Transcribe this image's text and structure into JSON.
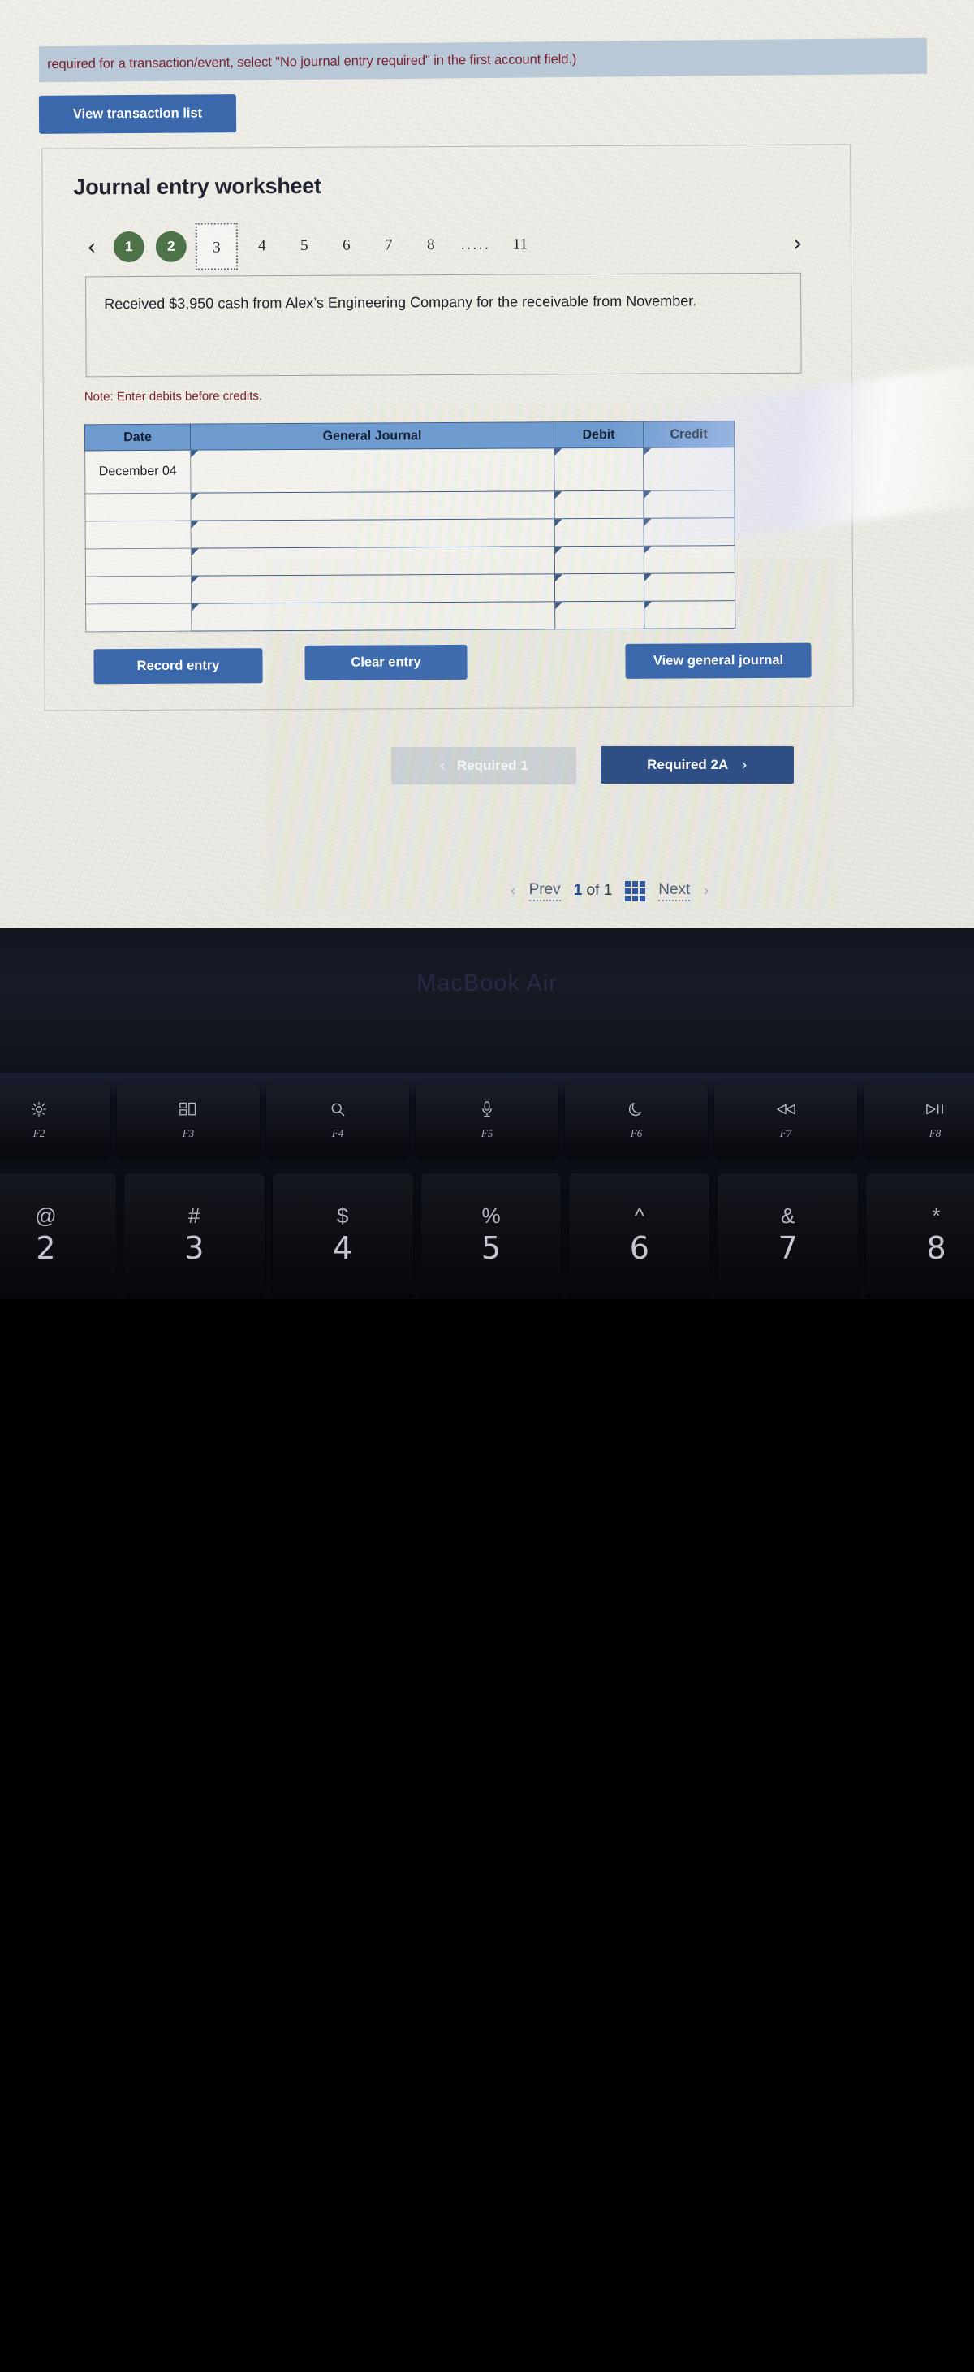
{
  "instruction": {
    "banner_text": "required for a transaction/event, select \"No journal entry required\" in the first account field.)"
  },
  "toolbar": {
    "view_transaction_list_label": "View transaction list"
  },
  "worksheet": {
    "title": "Journal entry worksheet",
    "prev_chevron": "‹",
    "next_chevron": "›",
    "tabs": [
      {
        "label": "1",
        "state": "completed"
      },
      {
        "label": "2",
        "state": "completed"
      },
      {
        "label": "3",
        "state": "current"
      },
      {
        "label": "4",
        "state": "normal"
      },
      {
        "label": "5",
        "state": "normal"
      },
      {
        "label": "6",
        "state": "normal"
      },
      {
        "label": "7",
        "state": "normal"
      },
      {
        "label": "8",
        "state": "normal"
      },
      {
        "label": ".....",
        "state": "ellipsis"
      },
      {
        "label": "11",
        "state": "normal"
      }
    ],
    "transaction_text": "Received $3,950 cash from Alex’s Engineering Company for the receivable from November.",
    "note": "Note: Enter debits before credits."
  },
  "table": {
    "headers": [
      "Date",
      "General Journal",
      "Debit",
      "Credit"
    ],
    "rows": [
      {
        "date": "December 04",
        "general_journal": "",
        "debit": "",
        "credit": ""
      },
      {
        "date": "",
        "general_journal": "",
        "debit": "",
        "credit": ""
      },
      {
        "date": "",
        "general_journal": "",
        "debit": "",
        "credit": ""
      },
      {
        "date": "",
        "general_journal": "",
        "debit": "",
        "credit": ""
      },
      {
        "date": "",
        "general_journal": "",
        "debit": "",
        "credit": ""
      },
      {
        "date": "",
        "general_journal": "",
        "debit": "",
        "credit": ""
      }
    ]
  },
  "actions": {
    "record_entry_label": "Record entry",
    "clear_entry_label": "Clear entry",
    "view_general_journal_label": "View general journal"
  },
  "required_nav": {
    "prev_label": "Required 1",
    "prev_chevron": "‹",
    "next_label": "Required 2A",
    "next_chevron": "›"
  },
  "pagination": {
    "prev_chevron": "‹",
    "prev_label": "Prev",
    "current_page": "1",
    "of_label": "of",
    "total_pages": "1",
    "next_label": "Next",
    "next_chevron": "›"
  },
  "device": {
    "model_label": "MacBook Air",
    "function_keys": [
      {
        "label": "F2",
        "icon": "brightness-icon",
        "glyph": "☼"
      },
      {
        "label": "F3",
        "icon": "mission-control-icon",
        "glyph": "☰"
      },
      {
        "label": "F4",
        "icon": "spotlight-search-icon",
        "glyph": "⚲"
      },
      {
        "label": "F5",
        "icon": "microphone-icon",
        "glyph": "Ψ"
      },
      {
        "label": "F6",
        "icon": "do-not-disturb-moon-icon",
        "glyph": "☾"
      },
      {
        "label": "F7",
        "icon": "rewind-icon",
        "glyph": "⧏◁"
      },
      {
        "label": "F8",
        "icon": "play-pause-icon",
        "glyph": "▷‖"
      }
    ],
    "number_keys": [
      {
        "symbol": "@",
        "digit": "2"
      },
      {
        "symbol": "#",
        "digit": "3"
      },
      {
        "symbol": "$",
        "digit": "4"
      },
      {
        "symbol": "%",
        "digit": "5"
      },
      {
        "symbol": "^",
        "digit": "6"
      },
      {
        "symbol": "&",
        "digit": "7"
      },
      {
        "symbol": "*",
        "digit": "8"
      }
    ]
  },
  "colors": {
    "primary_button": "#3b68ab",
    "table_header": "#6e9bd0",
    "tab_completed": "#4f7348",
    "note_text": "#7b2230",
    "banner_background": "#b9c8d6"
  }
}
